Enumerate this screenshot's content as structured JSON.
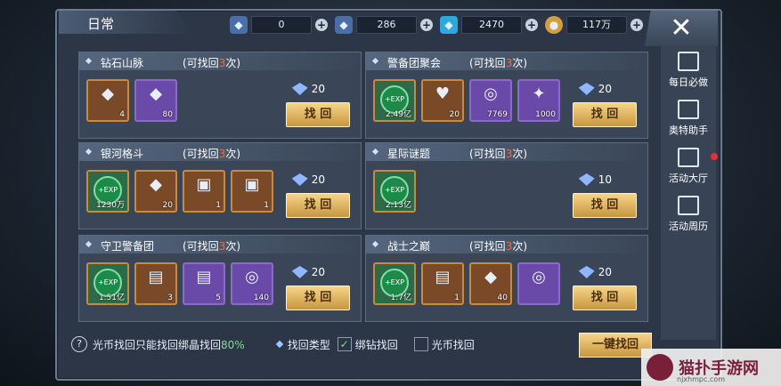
{
  "title": "日常",
  "resources": [
    {
      "icon": "bind-diamond-icon",
      "value": "0"
    },
    {
      "icon": "bind-diamond-icon",
      "value": "286"
    },
    {
      "icon": "diamond-icon",
      "value": "2470"
    },
    {
      "icon": "coin-icon",
      "value": "117万"
    }
  ],
  "panels": [
    {
      "name": "钻石山脉",
      "times_prefix": "(可找回",
      "times_num": "3",
      "times_suffix": "次)",
      "cost": "20",
      "button": "找 回",
      "items": [
        {
          "kind": "gold",
          "glyph": "◆",
          "count": "4"
        },
        {
          "kind": "purple",
          "glyph": "◆",
          "count": "80"
        }
      ]
    },
    {
      "name": "警备团聚会",
      "times_prefix": "(可找回",
      "times_num": "3",
      "times_suffix": "次)",
      "cost": "20",
      "button": "找 回",
      "items": [
        {
          "kind": "exp",
          "glyph": "+EXP",
          "count": "2.49亿"
        },
        {
          "kind": "gold",
          "glyph": "♥",
          "count": "20"
        },
        {
          "kind": "purple",
          "glyph": "◎",
          "count": "7769"
        },
        {
          "kind": "purple",
          "glyph": "✦",
          "count": "1000"
        }
      ]
    },
    {
      "name": "银河格斗",
      "times_prefix": "(可找回",
      "times_num": "3",
      "times_suffix": "次)",
      "cost": "20",
      "button": "找 回",
      "items": [
        {
          "kind": "exp",
          "glyph": "+EXP",
          "count": "1230万"
        },
        {
          "kind": "gold",
          "glyph": "◆",
          "count": "20"
        },
        {
          "kind": "gold",
          "glyph": "▣",
          "count": "1"
        },
        {
          "kind": "gold",
          "glyph": "▣",
          "count": "1"
        }
      ]
    },
    {
      "name": "星际谜题",
      "times_prefix": "(可找回",
      "times_num": "3",
      "times_suffix": "次)",
      "cost": "10",
      "button": "找 回",
      "items": [
        {
          "kind": "exp",
          "glyph": "+EXP",
          "count": "2.13亿"
        }
      ]
    },
    {
      "name": "守卫警备团",
      "times_prefix": "(可找回",
      "times_num": "3",
      "times_suffix": "次)",
      "cost": "20",
      "button": "找 回",
      "items": [
        {
          "kind": "exp",
          "glyph": "+EXP",
          "count": "1.51亿"
        },
        {
          "kind": "gold",
          "glyph": "▤",
          "count": "3"
        },
        {
          "kind": "purple",
          "glyph": "▤",
          "count": "5"
        },
        {
          "kind": "purple",
          "glyph": "◎",
          "count": "140"
        }
      ]
    },
    {
      "name": "战士之巅",
      "times_prefix": "(可找回",
      "times_num": "3",
      "times_suffix": "次)",
      "cost": "20",
      "button": "找 回",
      "items": [
        {
          "kind": "exp",
          "glyph": "+EXP",
          "count": "1.7亿"
        },
        {
          "kind": "gold",
          "glyph": "▤",
          "count": "1"
        },
        {
          "kind": "gold",
          "glyph": "◆",
          "count": "40"
        },
        {
          "kind": "purple",
          "glyph": "◎",
          "count": ""
        }
      ]
    }
  ],
  "side_menu": [
    "每日必做",
    "奥特助手",
    "活动大厅",
    "活动周历"
  ],
  "bottom": {
    "tip_prefix": "光币找回只能找回绑晶找回",
    "tip_percent": "80%",
    "type_label": "找回类型",
    "opt1": "绑钻找回",
    "opt2": "光币找回",
    "onekey": "一键找回"
  },
  "watermark": {
    "title": "猫扑手游网",
    "url": "njxhmpc.com"
  }
}
